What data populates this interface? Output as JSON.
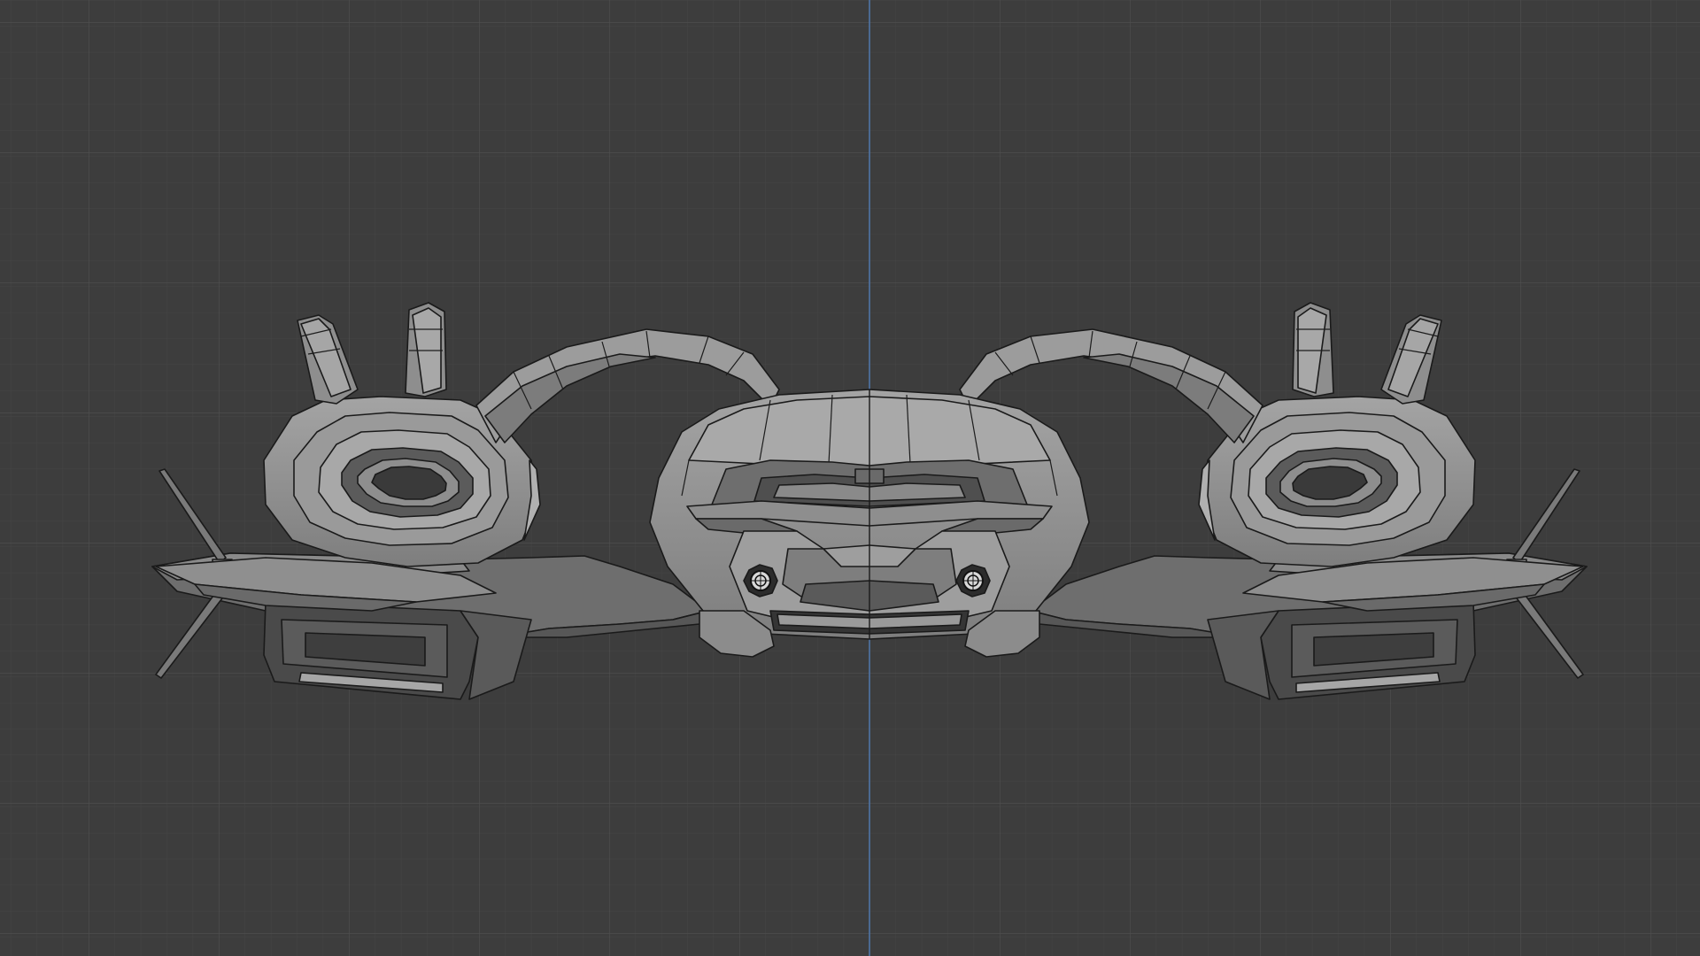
{
  "viewport": {
    "view": "front-orthographic",
    "shading": "solid",
    "background_color": "#3d3d3d",
    "grid_minor_color": "#454545",
    "grid_major_color": "#505050",
    "axis_z_color": "#4f74a6",
    "object": {
      "name": "spaceship-mesh",
      "light_face_color": "#9a9a9a",
      "mid_face_color": "#7c7c7c",
      "dark_face_color": "#4a4a4a",
      "edge_color": "#1a1a1a"
    }
  }
}
